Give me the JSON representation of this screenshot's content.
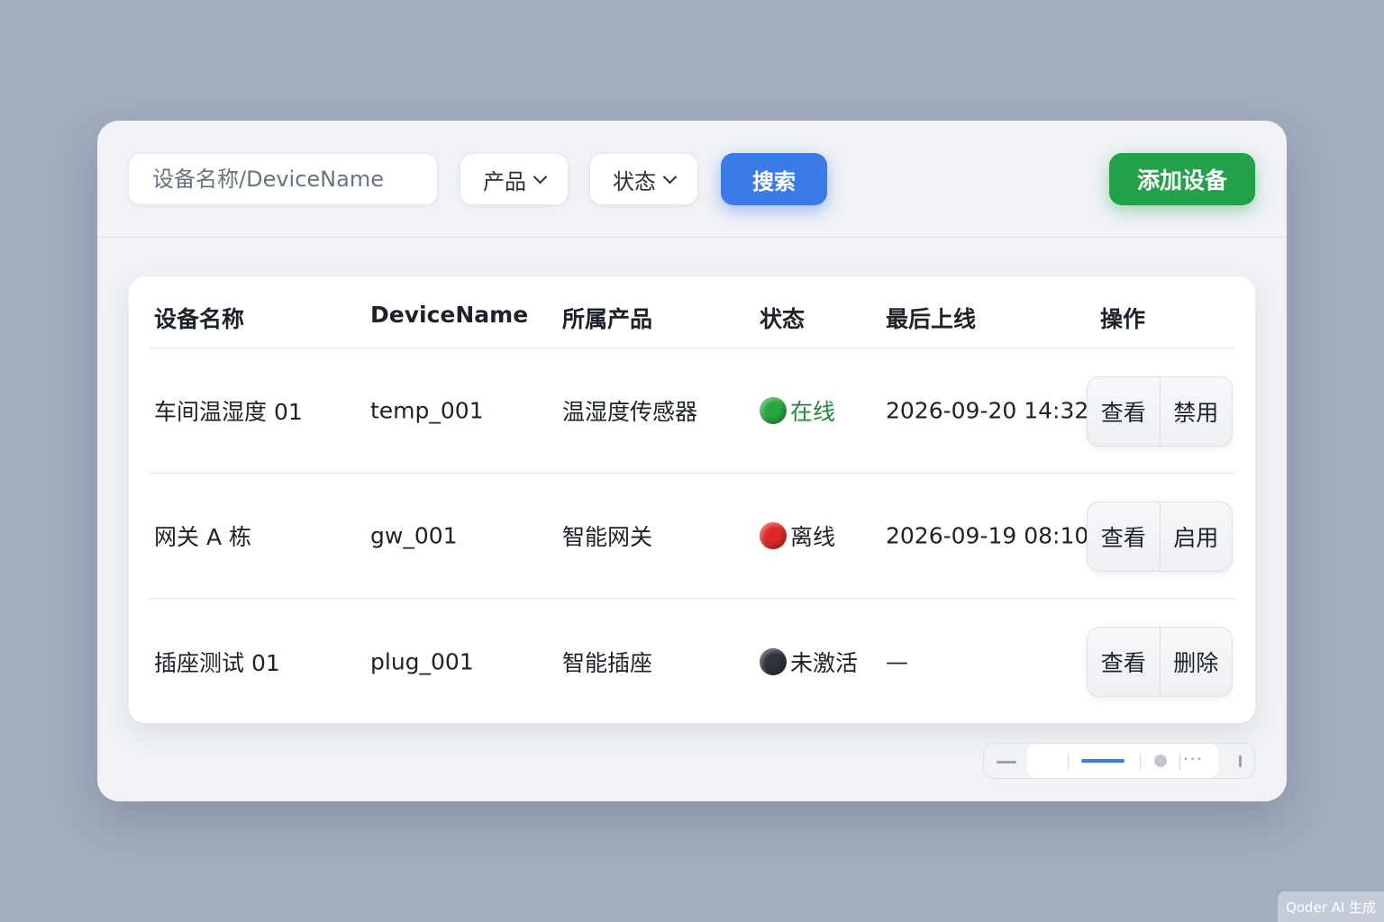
{
  "toolbar": {
    "search_placeholder": "设备名称/DeviceName",
    "product_select": "产品",
    "status_select": "状态",
    "search_button": "搜索",
    "add_button": "添加设备"
  },
  "table": {
    "columns": [
      "设备名称",
      "DeviceName",
      "所属产品",
      "状态",
      "最后上线",
      "操作"
    ],
    "rows": [
      {
        "name": "车间温湿度 01",
        "device_name": "temp_001",
        "product": "温湿度传感器",
        "status": "在线",
        "status_color": "#2aa63f",
        "status_text_color": "#1f8a36",
        "last_online": "2026-09-20 14:32",
        "actions": [
          "查看",
          "禁用"
        ]
      },
      {
        "name": "网关 A 栋",
        "device_name": "gw_001",
        "product": "智能网关",
        "status": "离线",
        "status_color": "#e02828",
        "status_text_color": "#1d2129",
        "last_online": "2026-09-19 08:10",
        "actions": [
          "查看",
          "启用"
        ]
      },
      {
        "name": "插座测试 01",
        "device_name": "plug_001",
        "product": "智能插座",
        "status": "未激活",
        "status_color": "#2e333c",
        "status_text_color": "#1d2129",
        "last_online": "—",
        "actions": [
          "查看",
          "删除"
        ]
      }
    ]
  },
  "pagination": {
    "prev_icon": "minus-icon",
    "active_icon": "active-page-line",
    "dot_icon": "page-dot-icon",
    "more_icon": "ellipsis-icon"
  },
  "watermark": "Qoder AI 生成",
  "colors": {
    "primary": "#3b7be8",
    "success": "#22a24a",
    "background": "#a2adbf",
    "panel": "#f0f2f6"
  }
}
